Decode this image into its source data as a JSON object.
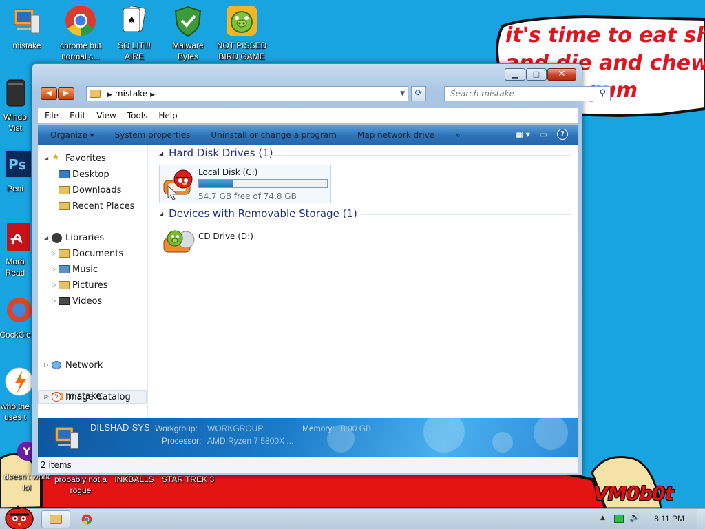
{
  "desktop": {
    "icons": [
      {
        "label": "mistake"
      },
      {
        "label": "chrome but normal c..."
      },
      {
        "label": "SO LIT!!! AIRE"
      },
      {
        "label": "Malware Bytes"
      },
      {
        "label": "NOT PISSED BIRD GAME"
      },
      {
        "label": "Windo Vist"
      },
      {
        "label": "Peni"
      },
      {
        "label": "Morb Read"
      },
      {
        "label": "CockCle"
      },
      {
        "label": "who the uses t"
      },
      {
        "label": "doesn't work lol"
      },
      {
        "label": "probably not a rogue"
      },
      {
        "label": "INKBALLS"
      },
      {
        "label": "STAR TREK 3"
      }
    ],
    "speech_bubble_lines": [
      "it's time to eat shit",
      "and die and chew",
      "gum"
    ],
    "signature": "VM0b0t",
    "colors": {
      "background": "#18a4e0",
      "accent_red": "#e0141e"
    }
  },
  "window": {
    "caption": {
      "minimize": "▁",
      "maximize": "□",
      "close": "✕"
    },
    "address": {
      "crumb": "mistake"
    },
    "search": {
      "placeholder": "Search mistake"
    },
    "menu": [
      "File",
      "Edit",
      "View",
      "Tools",
      "Help"
    ],
    "commands": [
      "Organize ▾",
      "System properties",
      "Uninstall or change a program",
      "Map network drive",
      "»"
    ],
    "nav": {
      "favorites": {
        "label": "Favorites",
        "items": [
          "Desktop",
          "Downloads",
          "Recent Places"
        ]
      },
      "libraries": {
        "label": "Libraries",
        "items": [
          "Documents",
          "Music",
          "Pictures",
          "Videos"
        ]
      },
      "computer": "mistake",
      "network": "Network",
      "image_catalog": "Image Catalog"
    },
    "groups": {
      "hdd": {
        "header": "Hard Disk Drives (1)",
        "drive": {
          "name": "Local Disk (C:)",
          "free_text": "54.7 GB free of 74.8 GB",
          "used_fraction": 0.27
        }
      },
      "removable": {
        "header": "Devices with Removable Storage (1)",
        "drive": {
          "name": "CD Drive (D:)"
        }
      }
    },
    "details": {
      "pc_name": "DILSHAD-SYS",
      "workgroup_key": "Workgroup:",
      "workgroup_val": "WORKGROUP",
      "memory_key": "Memory:",
      "memory_val": "8.00 GB",
      "processor_key": "Processor:",
      "processor_val": "AMD Ryzen 7 5800X ..."
    },
    "status": "2 items"
  },
  "taskbar": {
    "clock": "8:11 PM",
    "tray_arrow": "▲",
    "volume": "🔊"
  }
}
